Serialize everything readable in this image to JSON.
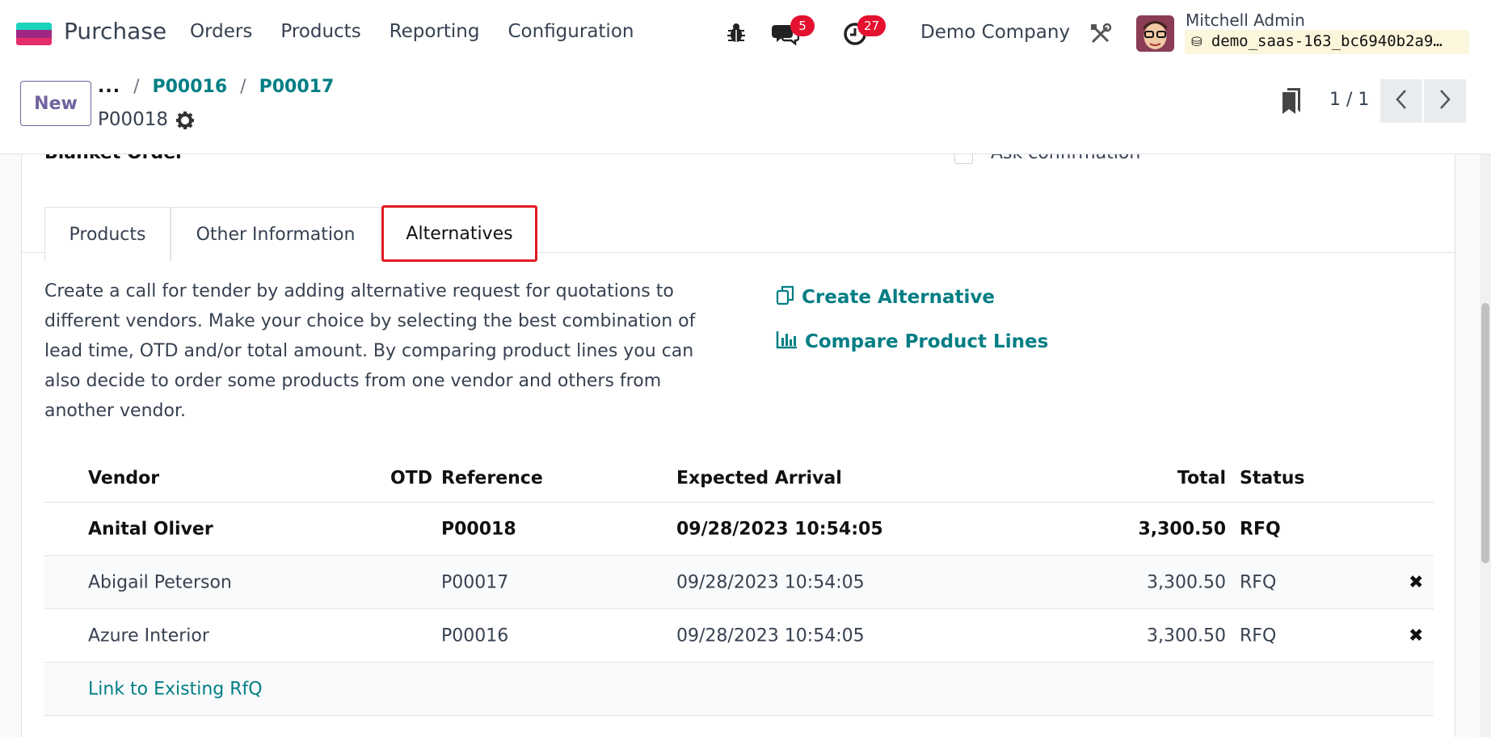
{
  "navbar": {
    "app_name": "Purchase",
    "logo_colors": [
      "#1ad3bb",
      "#a12683",
      "#e62d6a"
    ],
    "menu": [
      "Orders",
      "Products",
      "Reporting",
      "Configuration"
    ],
    "icons": {
      "debug": "bug-icon",
      "messages": "chat-icon",
      "activities": "clock-icon",
      "settings": "tools-icon"
    },
    "messages_count": "5",
    "activities_count": "27",
    "company": "Demo Company",
    "user_name": "Mitchell Admin",
    "database": "demo_saas-163_bc6940b2a9…"
  },
  "control_panel": {
    "new_label": "New",
    "breadcrumbs": [
      "...",
      "P00016",
      "P00017"
    ],
    "breadcrumb_sep": "/",
    "record_name": "P00018",
    "pager_value": "1 / 1"
  },
  "form": {
    "partial_field_label": "Blanket Order",
    "partial_checkbox_label": "Ask confirmation",
    "tabs": [
      "Products",
      "Other Information",
      "Alternatives"
    ],
    "active_tab": "Alternatives",
    "help_lines": [
      "Create a call for tender by adding alternative request for quotations to",
      "different vendors. Make your choice by selecting the best combination of",
      "lead time, OTD and/or total amount. By comparing product lines you can",
      "also decide to order some products from one vendor and others from",
      "another vendor."
    ],
    "create_alternative": "Create Alternative",
    "compare_lines": "Compare Product Lines"
  },
  "table": {
    "columns": [
      "Vendor",
      "OTD",
      "Reference",
      "Expected Arrival",
      "Total",
      "Status"
    ],
    "rows": [
      {
        "vendor": "Anital Oliver",
        "otd": "",
        "reference": "P00018",
        "arrival": "09/28/2023 10:54:05",
        "total": "3,300.50",
        "status": "RFQ",
        "deletable": false
      },
      {
        "vendor": "Abigail Peterson",
        "otd": "",
        "reference": "P00017",
        "arrival": "09/28/2023 10:54:05",
        "total": "3,300.50",
        "status": "RFQ",
        "deletable": true
      },
      {
        "vendor": "Azure Interior",
        "otd": "",
        "reference": "P00016",
        "arrival": "09/28/2023 10:54:05",
        "total": "3,300.50",
        "status": "RFQ",
        "deletable": true
      }
    ],
    "delete_glyph": "✖",
    "link_existing": "Link to Existing RfQ"
  },
  "colors": {
    "accent": "#017e84",
    "primary": "#71639e",
    "badge": "#e4112f",
    "highlight": "#e01b24"
  }
}
